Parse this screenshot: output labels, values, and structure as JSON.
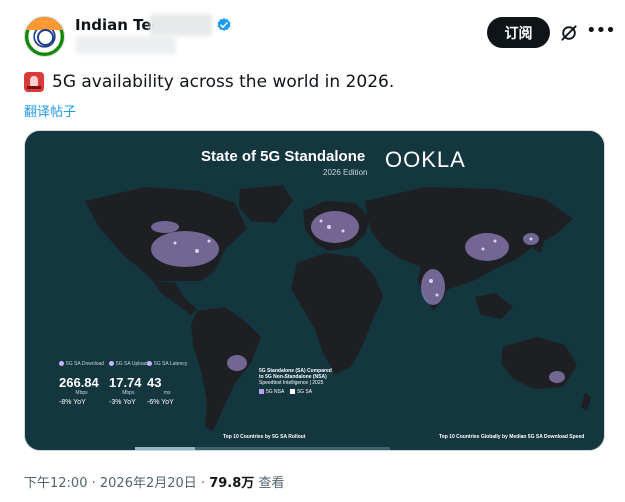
{
  "author": {
    "display_name": "Indian Tec",
    "handle": ""
  },
  "header": {
    "subscribe_label": "订阅"
  },
  "post": {
    "text": "5G availability across the world in 2026.",
    "translate_label": "翻译帖子",
    "time": "下午12:00",
    "date": "2026年2月20日",
    "views_count": "79.8万",
    "views_label": "查看",
    "separator": "·"
  },
  "image": {
    "title": "State of 5G Standalone",
    "edition": "2026 Edition",
    "logo": "OOKLA",
    "stats": [
      {
        "label": "5G SA Download",
        "value": "266.84",
        "unit": "Mbps",
        "yoy": "-8% YoY"
      },
      {
        "label": "5G SA Upload",
        "value": "17.74",
        "unit": "Mbps",
        "yoy": "-3% YoY"
      },
      {
        "label": "5G SA Latency",
        "value": "43",
        "unit": "ms",
        "yoy": "-6% YoY"
      }
    ],
    "legend_title": "5G Standalone (SA) Compared to 5G Non-Standalone (NSA)",
    "legend_source": "Speedtest Intelligence | 2025",
    "legend_items": [
      "5G NSA",
      "5G SA"
    ],
    "caption_left": "Top 10 Countries by 5G SA Rollout",
    "caption_right": "Top 10 Countries Globally by Median 5G SA Download Speed"
  },
  "colors": {
    "map_bg": "#14363f",
    "land": "#1d1f22",
    "coverage": "#b9a0f0",
    "link_blue": "#1d9bf0",
    "verified_blue": "#1d9bf0"
  }
}
